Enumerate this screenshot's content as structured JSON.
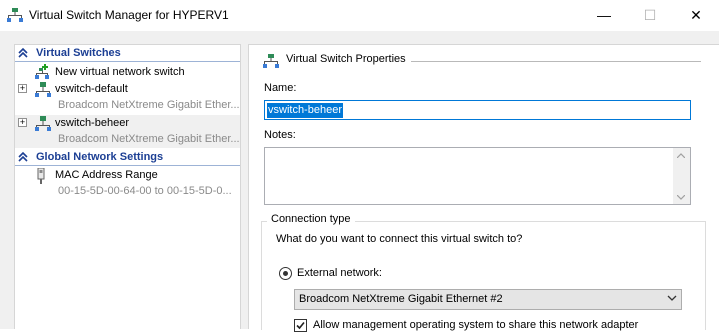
{
  "window": {
    "title": "Virtual Switch Manager for HYPERV1",
    "minimize_glyph": "—",
    "maximize_glyph": "☐",
    "close_glyph": "✕"
  },
  "sidebar": {
    "virtual_switches_header": "Virtual Switches",
    "new_switch_label": "New virtual network switch",
    "switches": [
      {
        "name": "vswitch-default",
        "adapter": "Broadcom NetXtreme Gigabit Ether...",
        "expander": "+"
      },
      {
        "name": "vswitch-beheer",
        "adapter": "Broadcom NetXtreme Gigabit Ether...",
        "expander": "+"
      }
    ],
    "global_settings_header": "Global Network Settings",
    "mac_range": {
      "label": "MAC Address Range",
      "value": "00-15-5D-00-64-00 to 00-15-5D-0..."
    }
  },
  "properties": {
    "title": "Virtual Switch Properties",
    "name_label": "Name:",
    "name_value": "vswitch-beheer",
    "notes_label": "Notes:",
    "notes_value": "",
    "connection_type_label": "Connection type",
    "connection_question": "What do you want to connect this virtual switch to?",
    "external_network_label": "External network:",
    "adapter_selected": "Broadcom NetXtreme Gigabit Ethernet #2",
    "allow_mgmt_label": "Allow management operating system to share this network adapter"
  },
  "colors": {
    "accent": "#0078d7",
    "section_header_text": "#1c3f94"
  }
}
